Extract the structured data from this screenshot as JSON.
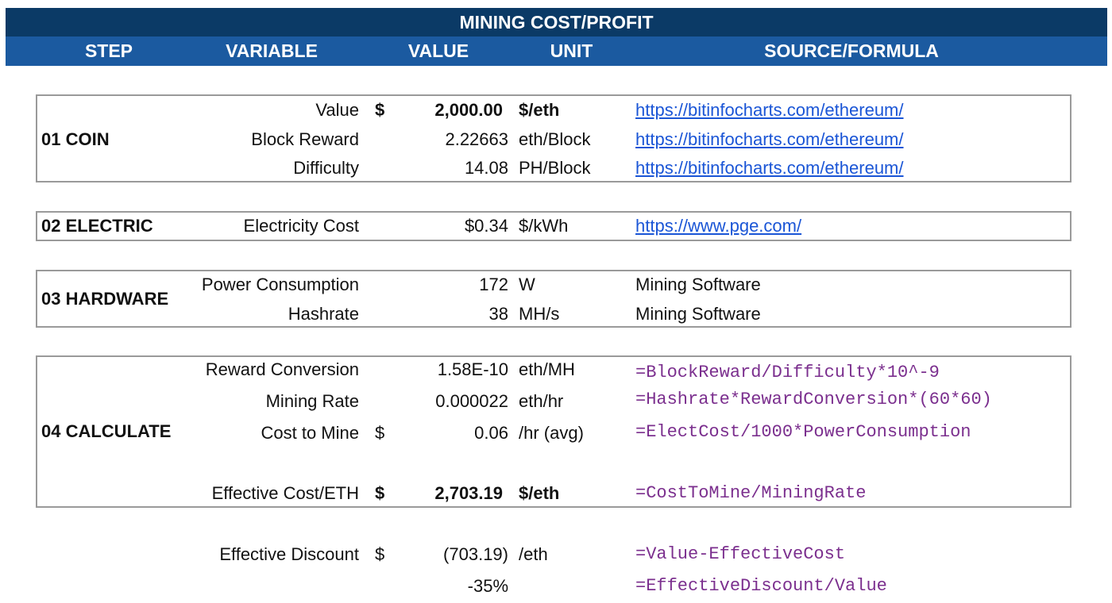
{
  "title": "MINING COST/PROFIT",
  "headers": {
    "step": "STEP",
    "variable": "VARIABLE",
    "value": "VALUE",
    "unit": "UNIT",
    "source": "SOURCE/FORMULA"
  },
  "coin": {
    "step": "01 COIN",
    "rows": [
      {
        "variable": "Value",
        "currency": "$",
        "value": "2,000.00",
        "unit": "$/eth",
        "source": "https://bitinfocharts.com/ethereum/"
      },
      {
        "variable": "Block Reward",
        "currency": "",
        "value": "2.22663",
        "unit": "eth/Block",
        "source": "https://bitinfocharts.com/ethereum/"
      },
      {
        "variable": "Difficulty",
        "currency": "",
        "value": "14.08",
        "unit": "PH/Block",
        "source": "https://bitinfocharts.com/ethereum/"
      }
    ]
  },
  "electric": {
    "step": "02 ELECTRIC",
    "rows": [
      {
        "variable": "Electricity Cost",
        "currency": "",
        "value": "$0.34",
        "unit": "$/kWh",
        "source": "https://www.pge.com/"
      }
    ]
  },
  "hardware": {
    "step": "03 HARDWARE",
    "rows": [
      {
        "variable": "Power Consumption",
        "currency": "",
        "value": "172",
        "unit": "W",
        "source": "Mining Software"
      },
      {
        "variable": "Hashrate",
        "currency": "",
        "value": "38",
        "unit": "MH/s",
        "source": "Mining Software"
      }
    ]
  },
  "calculate": {
    "step": "04 CALCULATE",
    "rows": [
      {
        "variable": "Reward Conversion",
        "currency": "",
        "value": "1.58E-10",
        "unit": "eth/MH",
        "source": "=BlockReward/Difficulty*10^-9"
      },
      {
        "variable": "Mining Rate",
        "currency": "",
        "value": "0.000022",
        "unit": "eth/hr",
        "source": "=Hashrate*RewardConversion*(60*60)"
      },
      {
        "variable": "Cost to Mine",
        "currency": "$",
        "value": "0.06",
        "unit": "/hr (avg)",
        "source": "=ElectCost/1000*PowerConsumption"
      },
      {
        "variable": "Effective Cost/ETH",
        "currency": "$",
        "value": "2,703.19",
        "unit": "$/eth",
        "source": "=CostToMine/MiningRate"
      }
    ]
  },
  "discount": {
    "rows": [
      {
        "variable": "Effective Discount",
        "currency": "$",
        "value": "(703.19)",
        "unit": "/eth",
        "source": "=Value-EffectiveCost"
      },
      {
        "variable": "",
        "currency": "",
        "value": "-35%",
        "unit": "",
        "source": "=EffectiveDiscount/Value"
      }
    ]
  },
  "colors": {
    "title_bg": "#0b3a66",
    "header_bg": "#1b5aa0",
    "link": "#1a55d6",
    "formula": "#7b2f8e",
    "border": "#9a9a9a"
  }
}
